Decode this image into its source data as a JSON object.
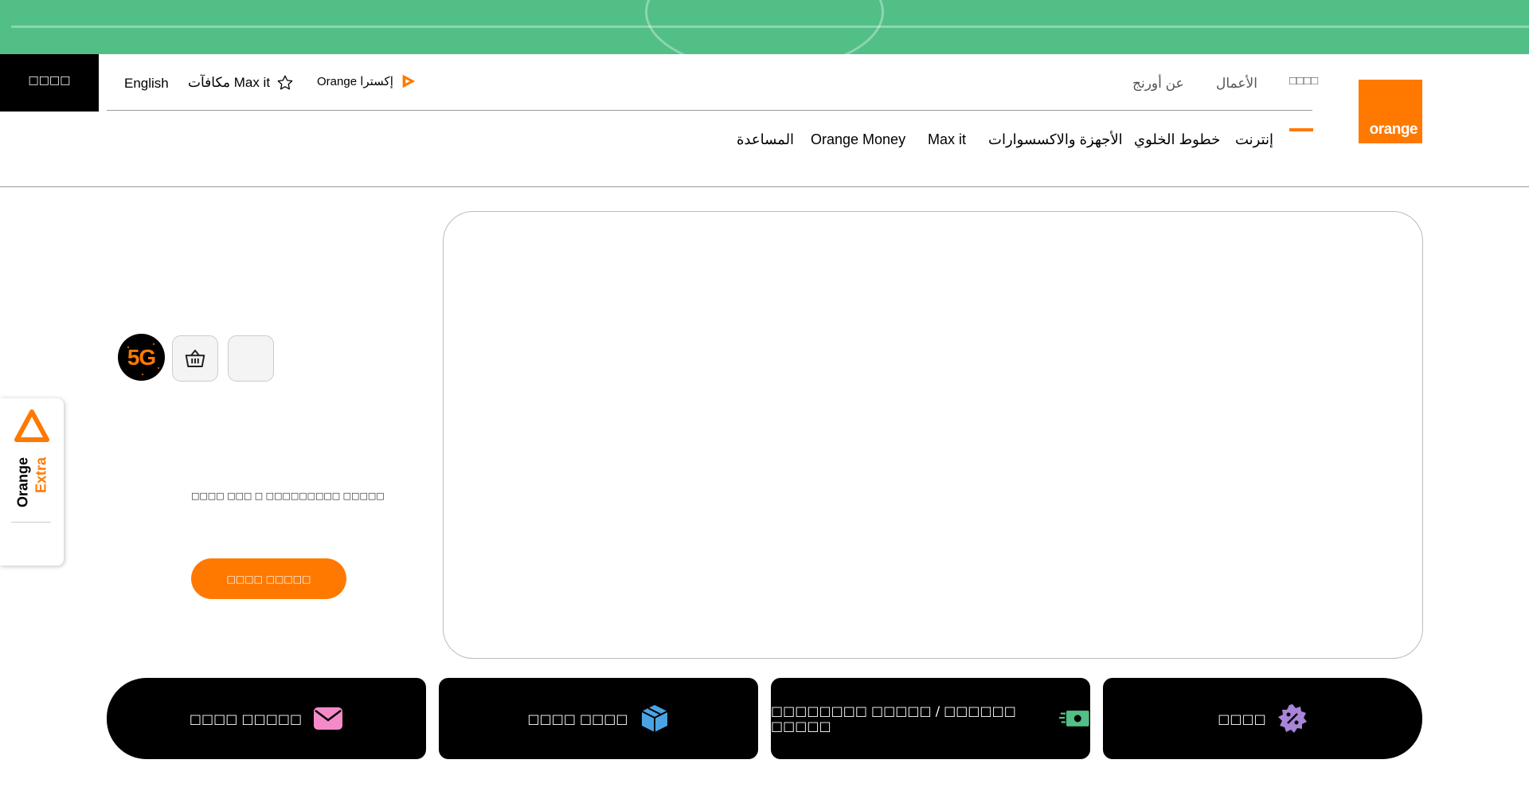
{
  "banner": {},
  "utility": {
    "login_label": "□□□□",
    "english_label": "English",
    "maxit_rewards_label": "مكافآت Max it",
    "orange_extra_label": "Orange إكسترا"
  },
  "segments": {
    "active_label": "□□□□",
    "business_label": "الأعمال",
    "about_label": "عن أورنج"
  },
  "logo": {
    "text": "orange"
  },
  "main_nav": {
    "items": [
      "إنترنت",
      "خطوط الخلوي",
      "الأجهزة والاكسسوارات",
      "Max it",
      "Orange Money",
      "المساعدة"
    ]
  },
  "hero": {
    "badge_5g": "5G",
    "text": "□□□□ □□□ □ □□□□□□□□□ □□□□□",
    "cta_label": "□□□□ □□□□□"
  },
  "extra_tab": {
    "orange_label": "Orange",
    "extra_label": "Extra"
  },
  "tiles": [
    {
      "label": "□□□□ □□□□□",
      "icon": "envelope-icon"
    },
    {
      "label": "□□□□ □□□□",
      "icon": "box-icon"
    },
    {
      "label": "□□□□□□□□ □□□□□ / □□□□□□ □□□□□",
      "icon": "cash-icon"
    },
    {
      "label": "□□□□",
      "icon": "discount-badge-icon"
    }
  ],
  "colors": {
    "accent": "#ff7900",
    "banner": "#52bf86",
    "dark": "#000000",
    "envelope": "#f58ac9",
    "box": "#4ba3e3",
    "cash": "#52bf86",
    "badge": "#a885d8"
  }
}
